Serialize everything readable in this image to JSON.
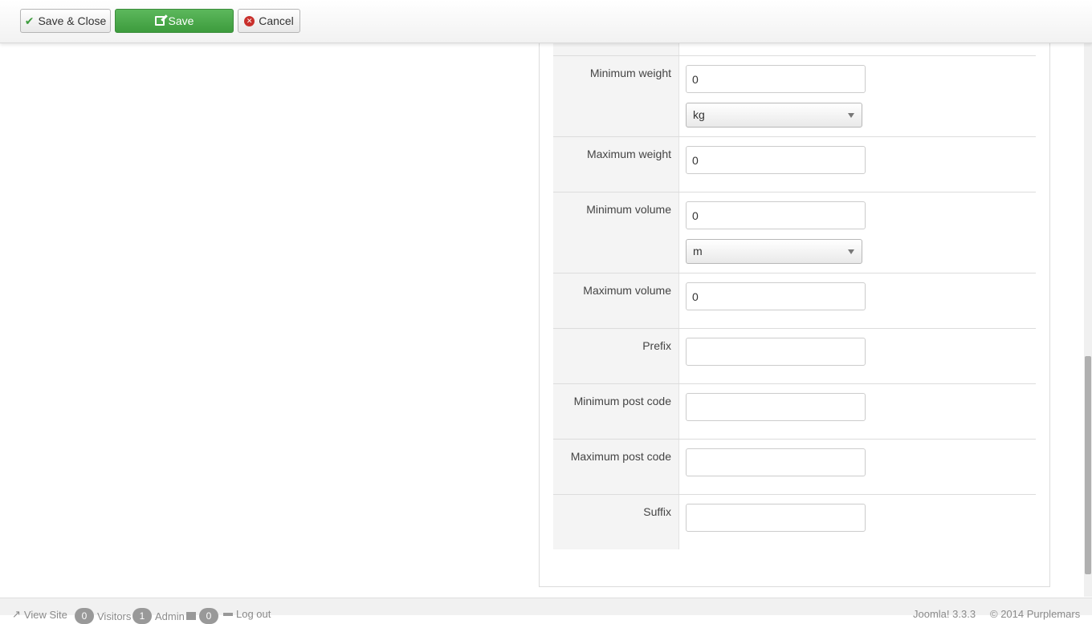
{
  "toolbar": {
    "save_close_label": "Save & Close",
    "save_label": "Save",
    "cancel_label": "Cancel"
  },
  "form": {
    "min_weight": {
      "label": "Minimum weight",
      "value": "0",
      "unit": "kg"
    },
    "max_weight": {
      "label": "Maximum weight",
      "value": "0"
    },
    "min_volume": {
      "label": "Minimum volume",
      "value": "0",
      "unit": "m"
    },
    "max_volume": {
      "label": "Maximum volume",
      "value": "0"
    },
    "prefix": {
      "label": "Prefix",
      "value": ""
    },
    "min_post_code": {
      "label": "Minimum post code",
      "value": ""
    },
    "max_post_code": {
      "label": "Maximum post code",
      "value": ""
    },
    "suffix": {
      "label": "Suffix",
      "value": ""
    }
  },
  "footer": {
    "view_site": "View Site",
    "visitors_count": "0",
    "visitors_label": "Visitors",
    "admin_count": "1",
    "admin_label": "Admin",
    "messages_count": "0",
    "logout_label": "Log out",
    "version": "Joomla! 3.3.3",
    "copyright": "© 2014 Purplemars"
  },
  "colors": {
    "save_green": "#5cb85c",
    "cancel_red": "#c9302c",
    "label_bg": "#f4f4f4"
  }
}
